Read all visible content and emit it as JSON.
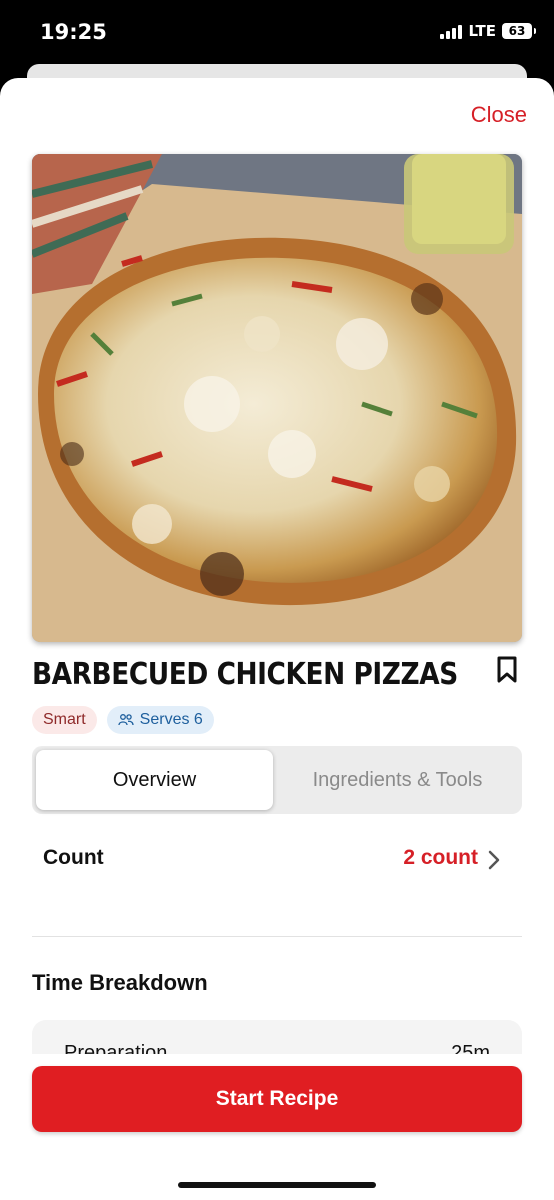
{
  "status_bar": {
    "time": "19:25",
    "network": "LTE",
    "battery": "63"
  },
  "sheet": {
    "close_label": "Close"
  },
  "recipe": {
    "title": "BARBECUED CHICKEN PIZZAS",
    "image_icon": "pizza-photo",
    "tags": [
      {
        "label": "Smart",
        "icon": ""
      },
      {
        "label": "Serves 6",
        "icon": "people-icon"
      }
    ]
  },
  "tabs": [
    {
      "label": "Overview",
      "active": true
    },
    {
      "label": "Ingredients & Tools",
      "active": false
    }
  ],
  "overview": {
    "count_label": "Count",
    "count_value": "2 count",
    "time_breakdown_title": "Time Breakdown",
    "time_rows": [
      {
        "label": "Preparation",
        "value": "25m"
      }
    ]
  },
  "footer": {
    "start_label": "Start Recipe"
  },
  "colors": {
    "accent": "#d62027",
    "button": "#e01e22",
    "tag_smart_bg": "#fbe9e8",
    "tag_serves_bg": "#e2eef9"
  }
}
